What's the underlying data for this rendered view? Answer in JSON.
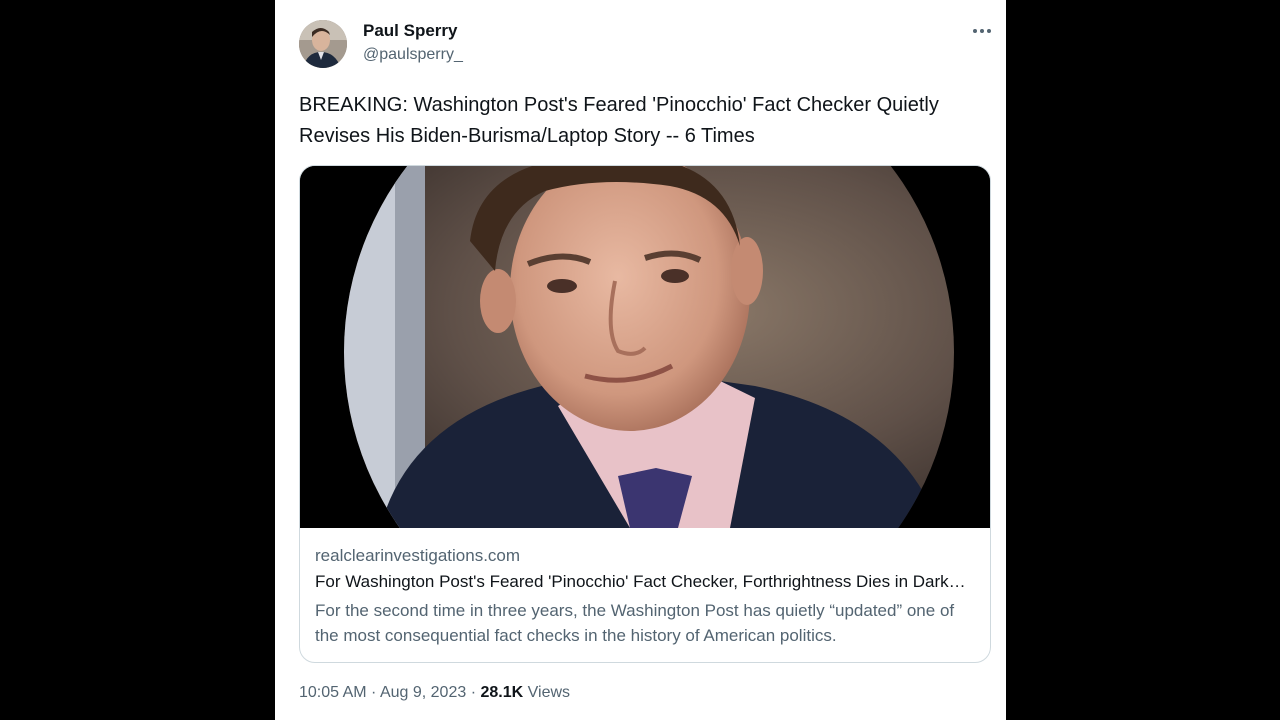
{
  "tweet": {
    "author": {
      "name": "Paul Sperry",
      "handle": "@paulsperry_",
      "avatar_icon": "profile-photo"
    },
    "more_icon": "more-horizontal-icon",
    "text": "BREAKING: Washington Post's Feared 'Pinocchio' Fact Checker Quietly Revises His Biden-Burisma/Laptop Story -- 6 Times",
    "card": {
      "domain": "realclearinvestigations.com",
      "title": "For Washington Post's Feared 'Pinocchio' Fact Checker, Forthrightness Dies in Darkness",
      "description": "For the second time in three years, the Washington Post has quietly “updated” one of the most consequential fact checks in the history of American politics."
    },
    "meta": {
      "time": "10:05 AM",
      "separator": " · ",
      "date": "Aug 9, 2023",
      "views_count": "28.1K",
      "views_label": "Views"
    }
  },
  "colors": {
    "text_primary": "#0f1419",
    "text_secondary": "#536471",
    "border": "#cfd9de",
    "background": "#ffffff",
    "frame": "#000000"
  }
}
